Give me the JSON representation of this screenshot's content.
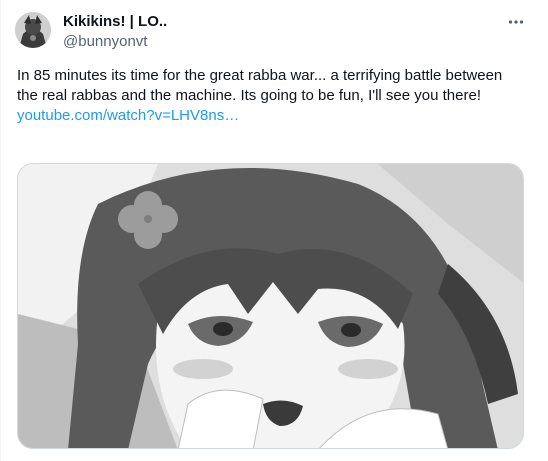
{
  "author": {
    "display_name": "Kikikins! | LO..",
    "handle": "@bunnyonvt"
  },
  "tweet": {
    "text": "In 85 minutes its time for the great rabba war... a terrifying battle between the real rabbas and the machine. Its going to be fun, I'll see you there!",
    "link": "youtube.com/watch?v=LHV8ns…"
  },
  "icons": {
    "more": "more-horizontal-icon"
  }
}
